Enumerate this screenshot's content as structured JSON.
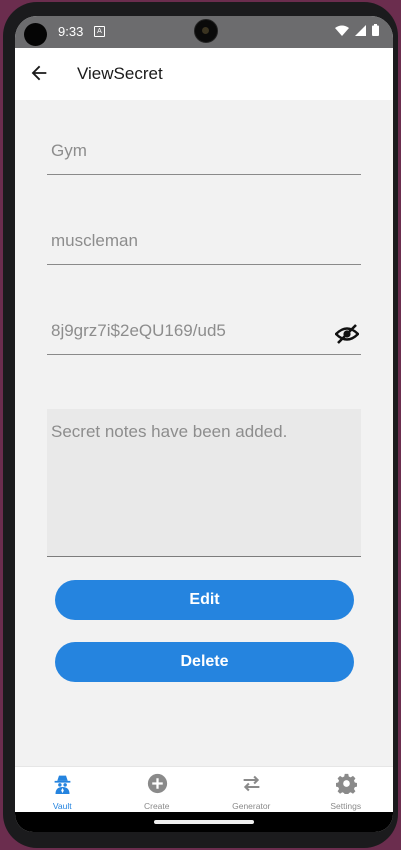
{
  "status": {
    "time": "9:33",
    "notif_glyph": "A",
    "icons": [
      "wifi-icon",
      "signal-icon",
      "battery-icon"
    ]
  },
  "appbar": {
    "title": "ViewSecret",
    "back_icon": "arrow-left-icon"
  },
  "fields": {
    "name": "Gym",
    "username": "muscleman",
    "password": "8j9grz7i$2eQU169/ud5",
    "password_toggle_icon": "eye-off-icon",
    "notes": "Secret notes have been added."
  },
  "buttons": {
    "edit": "Edit",
    "delete": "Delete"
  },
  "tabs": [
    {
      "label": "Vault",
      "icon": "spy-icon",
      "active": true
    },
    {
      "label": "Create",
      "icon": "plus-circle-icon",
      "active": false
    },
    {
      "label": "Generator",
      "icon": "swap-arrows-icon",
      "active": false
    },
    {
      "label": "Settings",
      "icon": "gear-icon",
      "active": false
    }
  ],
  "colors": {
    "accent": "#2584df",
    "background": "#f2f2f2",
    "statusbar": "#6c6c6e"
  }
}
